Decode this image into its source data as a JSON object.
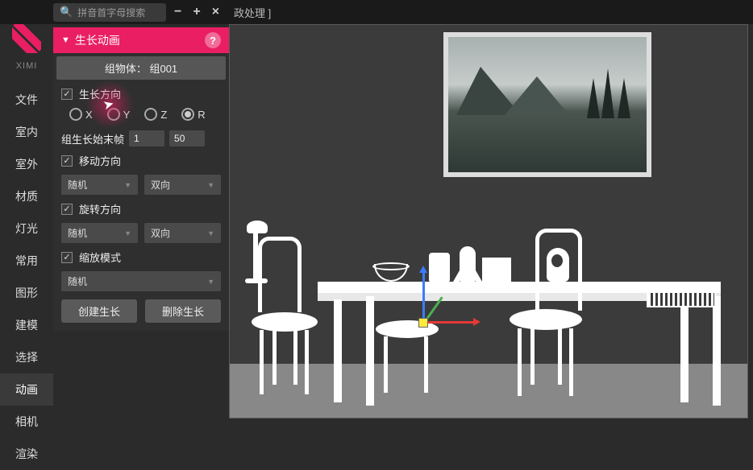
{
  "topbar": {
    "search_placeholder": "拼音首字母搜索",
    "tab_label": "政处理 ]"
  },
  "brand": "XIMI",
  "nav": {
    "items": [
      "文件",
      "室内",
      "室外",
      "材质",
      "灯光",
      "常用",
      "图形",
      "建模",
      "选择",
      "动画",
      "相机",
      "渲染"
    ],
    "active_index": 9
  },
  "panel": {
    "title": "生长动画",
    "group_obj_label": "组物体：",
    "group_obj_value": "组001",
    "grow_dir_label": "生长方向",
    "axes": {
      "x": "X",
      "y": "Y",
      "z": "Z",
      "r": "R",
      "selected": "R"
    },
    "frame_label": "组生长始末帧",
    "frame_start": "1",
    "frame_end": "50",
    "move_dir_label": "移动方向",
    "move_sel1": "随机",
    "move_sel2": "双向",
    "rotate_dir_label": "旋转方向",
    "rotate_sel1": "随机",
    "rotate_sel2": "双向",
    "scale_mode_label": "缩放模式",
    "scale_sel": "随机",
    "btn_create": "创建生长",
    "btn_delete": "删除生长"
  }
}
